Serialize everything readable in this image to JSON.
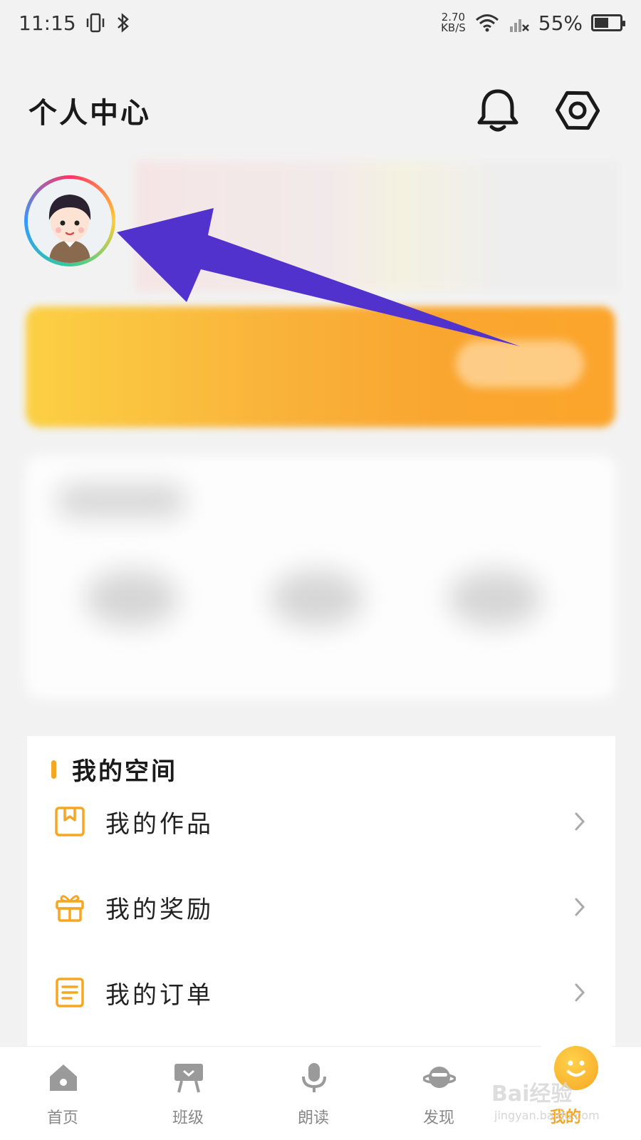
{
  "status_bar": {
    "time": "11:15",
    "net_speed_value": "2.70",
    "net_speed_unit": "KB/S",
    "battery": "55%",
    "battery_level": 0.55
  },
  "header": {
    "title": "个人中心",
    "icons": [
      "bell-icon",
      "settings-hex-icon"
    ]
  },
  "profile": {
    "avatar_icon": "cartoon-boy-avatar"
  },
  "my_space": {
    "title": "我的空间",
    "accent_color": "#f5a623",
    "items": [
      {
        "label": "我的作品",
        "icon": "bookmark-doc-icon"
      },
      {
        "label": "我的奖励",
        "icon": "gift-icon"
      },
      {
        "label": "我的订单",
        "icon": "order-list-icon"
      }
    ]
  },
  "bottom_nav": {
    "items": [
      {
        "label": "首页",
        "icon": "home-icon",
        "active": false
      },
      {
        "label": "班级",
        "icon": "class-flag-icon",
        "active": false
      },
      {
        "label": "朗读",
        "icon": "microphone-icon",
        "active": false
      },
      {
        "label": "发现",
        "icon": "planet-icon",
        "active": false
      },
      {
        "label": "我的",
        "icon": "smile-face-icon",
        "active": true
      }
    ],
    "active_color": "#f5a623",
    "inactive_color": "#888888"
  },
  "watermark": {
    "text": "Bai经验",
    "subtext": "jingyan.baidu.com"
  },
  "annotation_color": "#5232cc"
}
